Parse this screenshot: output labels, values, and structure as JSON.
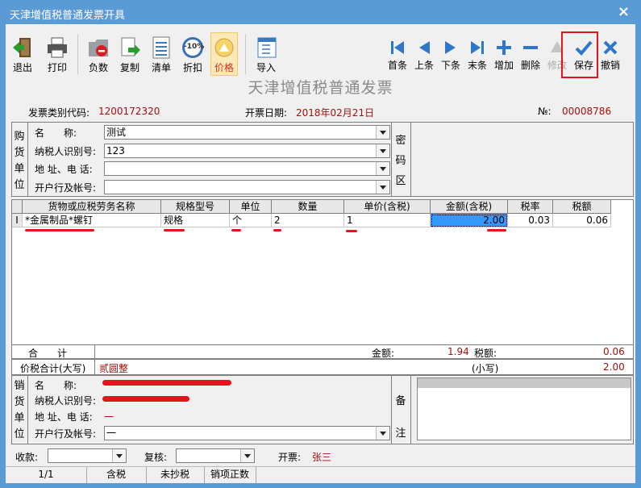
{
  "window": {
    "title": "天津增值税普通发票开具",
    "close_label": "×"
  },
  "toolbar": {
    "left": [
      {
        "label": "退出",
        "icon": "exit-icon"
      },
      {
        "label": "打印",
        "icon": "printer-icon"
      },
      {
        "label": "负数",
        "icon": "negative-invoice-icon"
      },
      {
        "label": "复制",
        "icon": "copy-icon"
      },
      {
        "label": "清单",
        "icon": "list-icon"
      },
      {
        "label": "折扣",
        "icon": "discount-icon",
        "badge": "-10%"
      },
      {
        "label": "价格",
        "icon": "price-icon"
      },
      {
        "label": "导入",
        "icon": "import-icon"
      }
    ],
    "right": [
      {
        "label": "首条",
        "icon": "first-record-icon"
      },
      {
        "label": "上条",
        "icon": "previous-record-icon"
      },
      {
        "label": "下条",
        "icon": "next-record-icon"
      },
      {
        "label": "末条",
        "icon": "last-record-icon"
      },
      {
        "label": "增加",
        "icon": "add-icon"
      },
      {
        "label": "删除",
        "icon": "delete-icon"
      },
      {
        "label": "修改",
        "icon": "edit-icon",
        "disabled": true
      },
      {
        "label": "保存",
        "icon": "save-check-icon"
      },
      {
        "label": "撤销",
        "icon": "cancel-icon"
      }
    ]
  },
  "invoice": {
    "title": "天津增值税普通发票",
    "type_code_label": "发票类别代码:",
    "type_code": "1200172320",
    "date_label": "开票日期:",
    "date": "2018年02月21日",
    "no_label": "№:",
    "no": "00008786"
  },
  "buyer": {
    "section_label": [
      "购",
      "货",
      "单",
      "位"
    ],
    "name_label": "名　　称:",
    "name": "测试",
    "tax_id_label": "纳税人识别号:",
    "tax_id": "123",
    "address_label": "地 址、电 话:",
    "address": "",
    "bank_label": "开户行及帐号:",
    "bank": "",
    "password_label": [
      "密",
      "码",
      "区"
    ]
  },
  "items": {
    "headers": [
      "货物或应税劳务名称",
      "规格型号",
      "单位",
      "数量",
      "单价(含税)",
      "金额(含税)",
      "税率",
      "税额"
    ],
    "rows": [
      {
        "marker": "I",
        "name": "*金属制品*螺钉",
        "spec": "规格",
        "unit": "个",
        "qty": "2",
        "price": "1",
        "amount": "2.00",
        "rate": "0.03",
        "tax": "0.06"
      }
    ]
  },
  "totals": {
    "total_label": "合　　计",
    "amount_label": "金额:",
    "amount": "1.94",
    "tax_label": "税额:",
    "tax": "0.06",
    "upper_label": "价税合计(大写)",
    "upper": "贰圆整",
    "lower_label": "(小写)",
    "lower": "2.00"
  },
  "seller": {
    "section_label": [
      "销",
      "货",
      "单",
      "位"
    ],
    "name_label": "名　　称:",
    "tax_id_label": "纳税人识别号:",
    "address_label": "地 址、电 话:",
    "address": "一",
    "bank_label": "开户行及帐号:",
    "bank": "一",
    "remark_label": [
      "备",
      "注"
    ]
  },
  "footer": {
    "payee_label": "收款:",
    "payee": "",
    "reviewer_label": "复核:",
    "reviewer": "",
    "drawer_label": "开票:",
    "drawer": "张三"
  },
  "status": [
    "1/1",
    "含税",
    "未抄税",
    "销项正数"
  ]
}
